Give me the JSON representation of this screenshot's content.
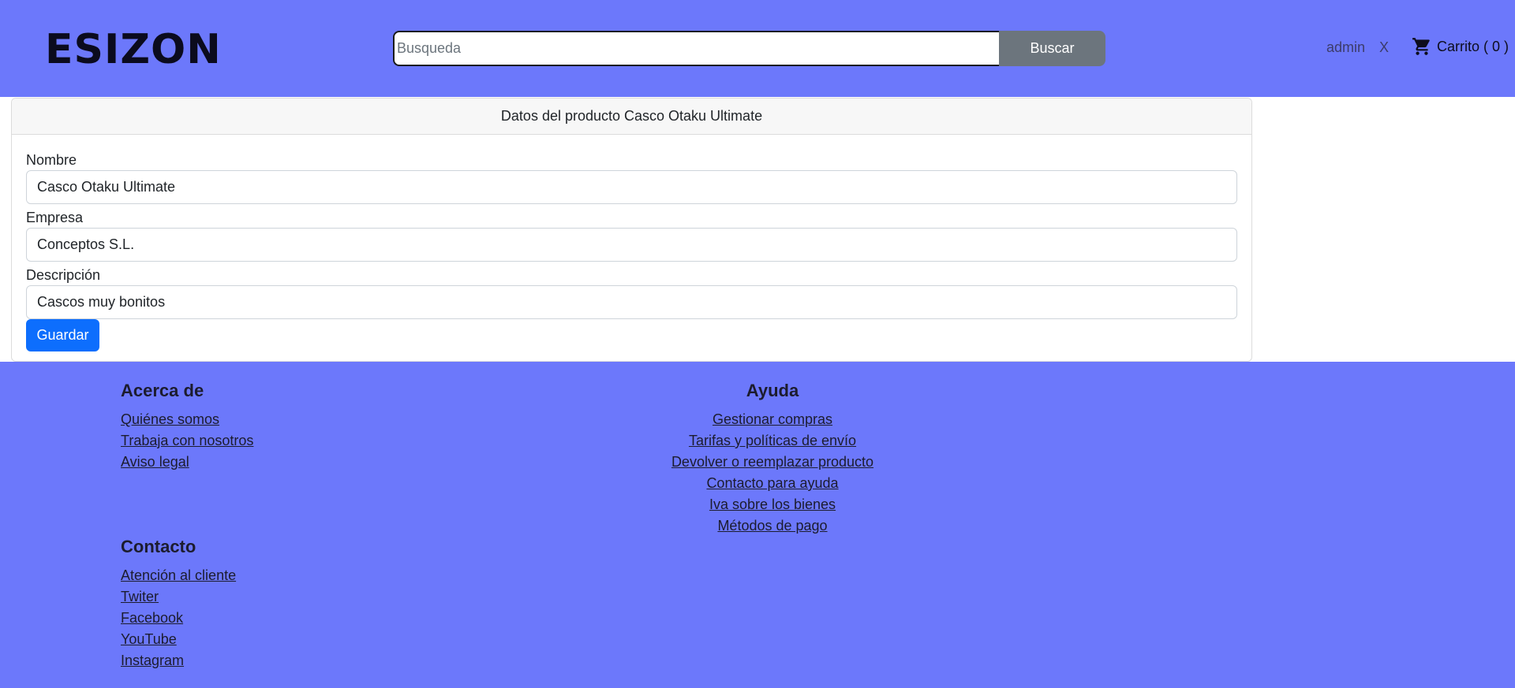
{
  "header": {
    "logo": "ESIZON",
    "search": {
      "placeholder": "Busqueda",
      "value": "",
      "button_label": "Buscar"
    },
    "user": "admin",
    "logout": "X",
    "cart": {
      "icon": "cart-icon",
      "label": "Carrito ( 0 )"
    }
  },
  "product_form": {
    "title": "Datos del producto Casco Otaku Ultimate",
    "fields": [
      {
        "label": "Nombre",
        "value": "Casco Otaku Ultimate"
      },
      {
        "label": "Empresa",
        "value": "Conceptos S.L."
      },
      {
        "label": "Descripción",
        "value": "Cascos muy bonitos"
      }
    ],
    "save_label": "Guardar"
  },
  "footer": {
    "about": {
      "title": "Acerca de",
      "links": [
        "Quiénes somos",
        "Trabaja con nosotros",
        "Aviso legal"
      ]
    },
    "help": {
      "title": "Ayuda",
      "links": [
        "Gestionar compras",
        "Tarifas y políticas de envío",
        "Devolver o reemplazar producto",
        "Contacto para ayuda",
        "Iva sobre los bienes",
        "Métodos de pago"
      ]
    },
    "contact": {
      "title": "Contacto",
      "links": [
        "Atención al cliente",
        "Twiter",
        "Facebook",
        "YouTube",
        "Instagram"
      ]
    }
  },
  "colors": {
    "header_bg": "#6c78fb",
    "footer_bg": "#6c78fb",
    "primary_button": "#0d6efd",
    "search_button": "#6c757d"
  }
}
